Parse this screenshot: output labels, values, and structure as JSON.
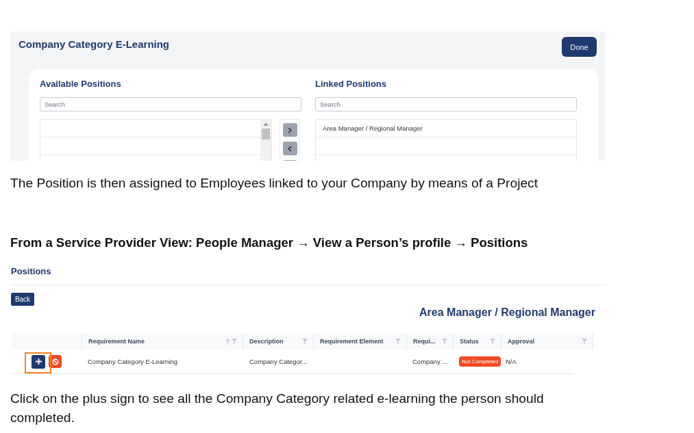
{
  "linking_screen": {
    "title": "Company Category E-Learning",
    "done_button": "Done",
    "available_positions": {
      "heading": "Available Positions",
      "search": {
        "placeholder": "Search"
      }
    },
    "linked_positions": {
      "heading": "Linked Positions",
      "search": {
        "placeholder": "Search"
      },
      "items": [
        "Area Manager / Regional Manager"
      ]
    }
  },
  "intro_text": "The Position is then assigned to Employees linked to your Company by means of a Project",
  "navigation_path": "From a Service Provider View: People Manager → View a Person’s profile → Positions",
  "positions_screen": {
    "title": "Positions",
    "back_button": "Back",
    "position_name": "Area Manager / Regional Manager",
    "table": {
      "columns": [
        {
          "label": "Requirement Name",
          "sortable": true
        },
        {
          "label": "Description",
          "sortable": false
        },
        {
          "label": "Requirement Element",
          "sortable": false
        },
        {
          "label": "Requi...",
          "sortable": false
        },
        {
          "label": "Status",
          "sortable": false
        },
        {
          "label": "Approval",
          "sortable": false
        }
      ],
      "rows": [
        {
          "highlighted": true,
          "requirement_name": "Company Category E-Learning",
          "description": "Company Categor...",
          "column_5": "Company ...",
          "status": "Not Completed",
          "approval": "N/A"
        }
      ]
    }
  },
  "instruction_text": "Click on the plus sign to see all the Company Category related e-learning the person should completed."
}
